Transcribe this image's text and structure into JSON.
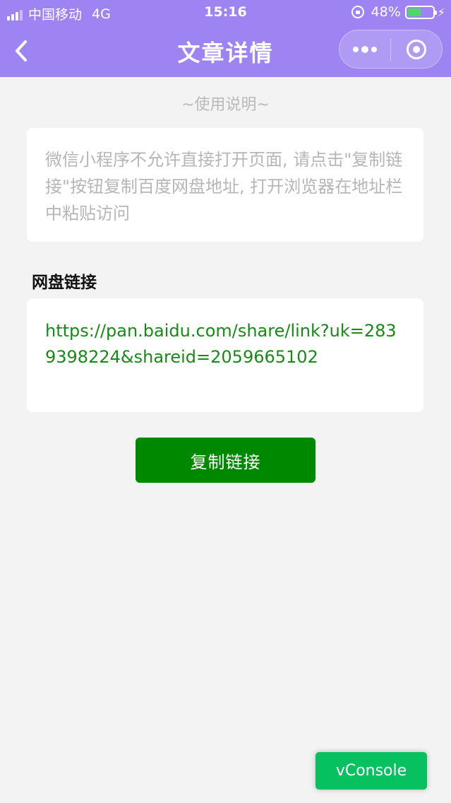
{
  "status_bar": {
    "carrier": "中国移动",
    "network": "4G",
    "time": "15:16",
    "battery_percent": "48%",
    "battery_level": 0.48,
    "icons": [
      "signal-icon",
      "orientation-lock-icon",
      "battery-icon",
      "charging-bolt-icon"
    ]
  },
  "nav": {
    "title": "文章详情",
    "back_icon": "chevron-left-icon",
    "more_icon": "more-dots-icon",
    "close_icon": "target-close-icon"
  },
  "usage": {
    "title": "~使用说明~",
    "notice": "微信小程序不允许直接打开页面, 请点击\"复制链接\"按钮复制百度网盘地址, 打开浏览器在地址栏中粘贴访问"
  },
  "link_section": {
    "title": "网盘链接",
    "url": "https://pan.baidu.com/share/link?uk=2839398224&shareid=2059665102"
  },
  "buttons": {
    "copy_label": "复制链接",
    "vconsole_label": "vConsole"
  },
  "colors": {
    "header_bg": "#9e84f2",
    "page_bg": "#f3f3f3",
    "link_text": "#178a17",
    "copy_button_bg": "#008800",
    "vconsole_bg": "#07c160"
  }
}
